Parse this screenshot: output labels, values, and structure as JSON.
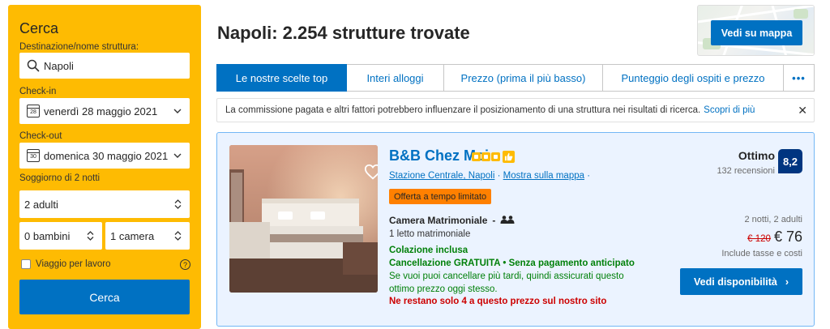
{
  "sidebar": {
    "title": "Cerca",
    "destination_label": "Destinazione/nome struttura:",
    "destination_value": "Napoli",
    "checkin_label": "Check-in",
    "checkin_value": "venerdì 28 maggio 2021",
    "checkin_day": "28",
    "checkout_label": "Check-out",
    "checkout_value": "domenica 30 maggio 2021",
    "checkout_day": "30",
    "stay_label": "Soggiorno di 2 notti",
    "adults": "2 adulti",
    "children": "0 bambini",
    "rooms": "1 camera",
    "business_label": "Viaggio per lavoro",
    "help_glyph": "?",
    "search_button": "Cerca"
  },
  "header": {
    "title": "Napoli: 2.254 strutture trovate",
    "map_button": "Vedi su mappa"
  },
  "tabs": [
    {
      "label": "Le nostre scelte top",
      "active": true
    },
    {
      "label": "Interi alloggi",
      "active": false
    },
    {
      "label": "Prezzo (prima il più basso)",
      "active": false
    },
    {
      "label": "Punteggio degli ospiti e prezzo",
      "active": false
    },
    {
      "label": "•••",
      "active": false
    }
  ],
  "notice": {
    "text": "La commissione pagata e altri fattori potrebbero influenzare il posizionamento di una struttura nei risultati di ricerca.",
    "link": "Scopri di più",
    "close": "✕"
  },
  "listing": {
    "name": "B&B Chez Moi",
    "stars": 3,
    "location": "Stazione Centrale, Napoli",
    "map_link": "Mostra sulla mappa",
    "deal_badge": "Offerta a tempo limitato",
    "room_type": "Camera Matrimoniale",
    "room_separator": "-",
    "bed_info": "1 letto matrimoniale",
    "breakfast": "Colazione inclusa",
    "cancellation": "Cancellazione GRATUITA • Senza pagamento anticipato",
    "cancellation_note": "Se vuoi puoi cancellare più tardi, quindi assicurati questo ottimo prezzo oggi stesso.",
    "scarcity": "Ne restano solo 4 a questo prezzo sul nostro sito",
    "rating_word": "Ottimo",
    "reviews": "132 recensioni",
    "score": "8,2",
    "nights": "2 notti, 2 adulti",
    "old_price": "€ 120",
    "new_price": "€ 76",
    "taxes": "Include tasse e costi",
    "availability_button": "Vedi disponibilità",
    "availability_arrow": "›"
  },
  "colors": {
    "brand_yellow": "#febb02",
    "brand_blue": "#0071c2",
    "dark_blue": "#003580",
    "green": "#008009",
    "red": "#cc0000",
    "deal_orange": "#ff8000"
  }
}
